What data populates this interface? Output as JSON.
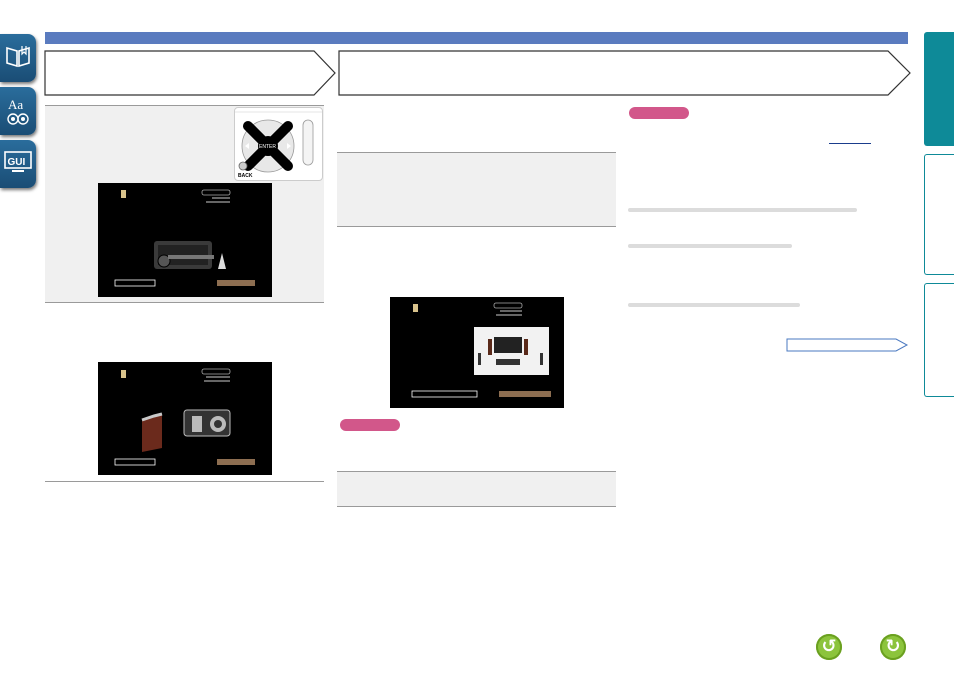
{
  "nav": {
    "sidebar": [
      {
        "name": "contents-icon"
      },
      {
        "name": "index-icon"
      },
      {
        "name": "gui-icon"
      }
    ],
    "back_glyph": "↺",
    "forward_glyph": "↻"
  },
  "remote": {
    "enter_label": "ENTER",
    "back_label": "BACK"
  },
  "colors": {
    "topbar": "#5a7bbf",
    "pill": "#d2578a",
    "right_tab_active": "#0e8a98",
    "nav_button": "#8cc43c"
  }
}
